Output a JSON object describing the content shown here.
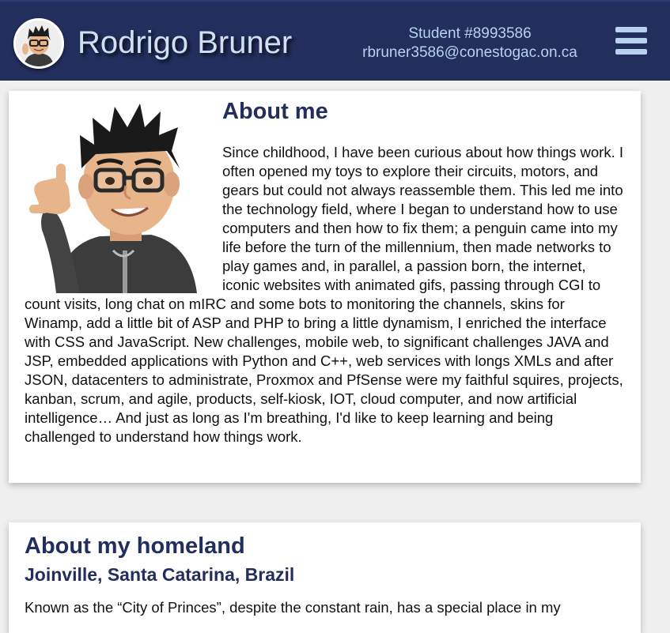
{
  "header": {
    "name": "Rodrigo Bruner",
    "student_id": "Student #8993586",
    "email": "rbruner3586@conestogac.on.ca",
    "menu_icon": "hamburger-menu-icon"
  },
  "about": {
    "heading": "About me",
    "bio": "Since childhood, I have been curious about how things work. I often opened my toys to explore their circuits, motors, and gears but could not always reassemble them. This led me into the technology field, where I began to understand how to use computers and then how to fix them; a penguin came into my life before the turn of the millennium, then made networks to play games and, in parallel, a passion born, the internet, iconic websites with animated gifs, passing through CGI to count visits, long chat on mIRC and some bots to monitoring the channels, skins for Winamp, add a little bit of ASP and PHP to bring a little dynamism, I enriched the interface with CSS and JavaScript. New challenges, mobile web, to significant challenges JAVA and JSP, embedded applications with Python and C++, web services with longs XMLs and after JSON, datacenters to administrate, Proxmox and PfSense were my faithful squires, projects, kanban, scrum, and agile, products, self-kiosk, IOT, cloud computer, and now artificial intelligence… And just as long as I'm breathing, I'd like to keep learning and being challenged to understand how things work."
  },
  "homeland": {
    "heading": "About my homeland",
    "subheading": "Joinville, Santa Catarina, Brazil",
    "intro": "Known as the “City of Princes”, despite the constant rain, has a special place in my"
  },
  "colors": {
    "header_bg": "#222e5c",
    "heading": "#222e5c",
    "header_text": "#b6d2ee"
  }
}
